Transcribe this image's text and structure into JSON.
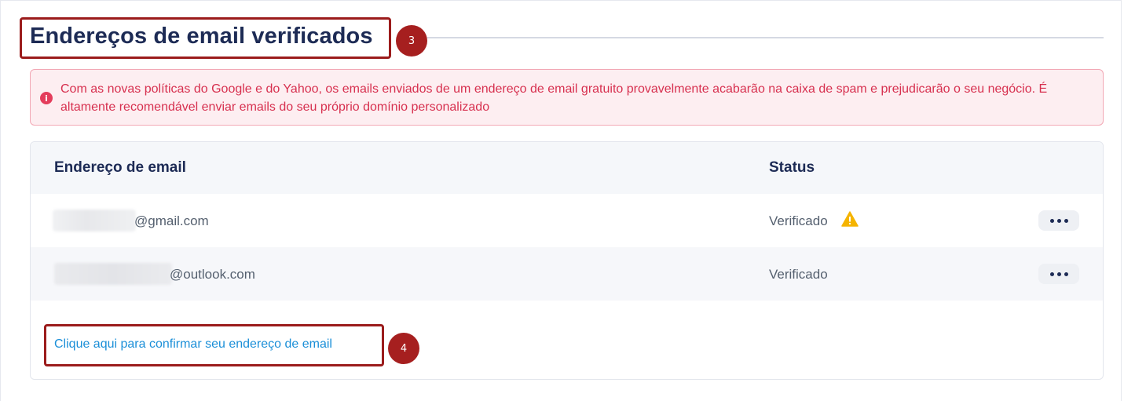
{
  "section": {
    "title": "Endereços de email verificados"
  },
  "alert": {
    "icon": "info-icon",
    "message": "Com as novas políticas do Google e do Yahoo, os emails enviados de um endereço de email gratuito provavelmente acabarão na caixa de spam e prejudicarão o seu negócio. É altamente recomendável enviar emails do seu próprio domínio personalizado"
  },
  "table": {
    "columns": [
      "Endereço de email",
      "Status"
    ],
    "rows": [
      {
        "email_domain": "@gmail.com",
        "status": "Verificado",
        "warning": true
      },
      {
        "email_domain": "@outlook.com",
        "status": "Verificado",
        "warning": false
      }
    ]
  },
  "confirm_link": "Clique aqui para confirmar seu endereço de email",
  "annotations": [
    "3",
    "4"
  ],
  "colors": {
    "title": "#1d2b55",
    "alert_text": "#d7304f",
    "alert_bg": "#fdeef1",
    "link": "#1b8fd8",
    "annotation": "#a61f1f",
    "warning": "#f5b400"
  }
}
